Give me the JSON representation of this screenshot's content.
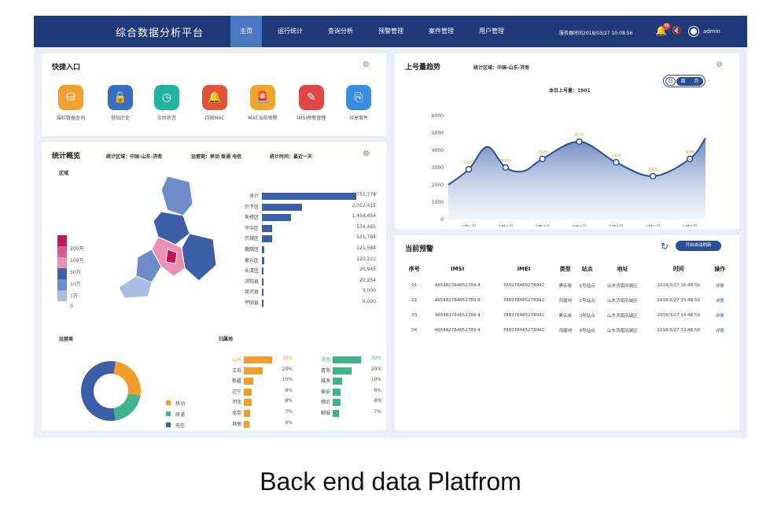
{
  "app": {
    "title": "综合数据分析平台",
    "nav": [
      "主页",
      "运行统计",
      "查询分析",
      "预警管理",
      "案件管理",
      "用户管理"
    ],
    "active_nav": "主页",
    "server_time": "服务器时间2018/03/27 10:08:56",
    "notification_count": "99",
    "user": "admin"
  },
  "quick": {
    "title": "快捷入口",
    "items": [
      {
        "label": "围栏数据查询",
        "icon": "database-search-icon",
        "color": "#f0a030"
      },
      {
        "label": "登陆历史",
        "icon": "lock-icon",
        "color": "#3a6cc0"
      },
      {
        "label": "实时状态",
        "icon": "clock-icon",
        "color": "#22b2a0"
      },
      {
        "label": "待宿MAC",
        "icon": "alarm-bell-icon",
        "color": "#e0543a"
      },
      {
        "label": "MAC当前预警",
        "icon": "siren-icon",
        "color": "#f2a42a"
      },
      {
        "label": "IMSI预警管理",
        "icon": "document-edit-icon",
        "color": "#e04848"
      },
      {
        "label": "共享案件",
        "icon": "share-document-icon",
        "color": "#3a8ce0"
      }
    ]
  },
  "stats": {
    "title": "统计概览",
    "region_label": "统计区域：中国-山东-济南",
    "carrier_label": "运营商：移动 联通 电信",
    "time_label": "统计时间：最近一天",
    "map_label": "区域",
    "legend": [
      {
        "label": "200万",
        "color": "#c2185b"
      },
      {
        "label": "100万",
        "color": "#d8598a"
      },
      {
        "label": "50万",
        "color": "#e891b3"
      },
      {
        "label": "10万",
        "color": "#3d5fa8"
      },
      {
        "label": "1万",
        "color": "#6d8cc8"
      },
      {
        "label": "0",
        "color": "#a9bde3"
      }
    ],
    "districts": [
      {
        "name": "总计",
        "value": 4755778,
        "label": "4,755,778"
      },
      {
        "name": "历下区",
        "value": 2012415,
        "label": "2,012,415"
      },
      {
        "name": "天桥区",
        "value": 1454454,
        "label": "1,454,454"
      },
      {
        "name": "市中区",
        "value": 534465,
        "label": "534,465"
      },
      {
        "name": "历城区",
        "value": 531784,
        "label": "531,784"
      },
      {
        "name": "槐荫区",
        "value": 121584,
        "label": "121,584"
      },
      {
        "name": "章丘区",
        "value": 120222,
        "label": "120,222"
      },
      {
        "name": "长清区",
        "value": 20945,
        "label": "20,945"
      },
      {
        "name": "济阳县",
        "value": 20254,
        "label": "20,254"
      },
      {
        "name": "商河县",
        "value": 9000,
        "label": "9,000"
      },
      {
        "name": "平阴县",
        "value": 9000,
        "label": "9,000"
      }
    ],
    "carrier_title": "运营商",
    "carriers": [
      {
        "name": "移动",
        "value": 25,
        "color": "#f29c2b"
      },
      {
        "name": "联通",
        "value": 20,
        "color": "#3fb38a"
      },
      {
        "name": "电信",
        "value": 55,
        "color": "#3a5ea8"
      }
    ],
    "home_title": "归属地",
    "provinces": [
      {
        "name": "山东",
        "value": 30,
        "label": "30%"
      },
      {
        "name": "江苏",
        "value": 20,
        "label": "20%"
      },
      {
        "name": "新疆",
        "value": 10,
        "label": "10%"
      },
      {
        "name": "辽宁",
        "value": 8,
        "label": "8%"
      },
      {
        "name": "河北",
        "value": 8,
        "label": "8%"
      },
      {
        "name": "北京",
        "value": 7,
        "label": "7%"
      },
      {
        "name": "其他",
        "value": 6,
        "label": "6%"
      }
    ],
    "cities": [
      {
        "name": "济南",
        "value": 30,
        "label": "30%"
      },
      {
        "name": "青岛",
        "value": 20,
        "label": "20%"
      },
      {
        "name": "威海",
        "value": 10,
        "label": "10%"
      },
      {
        "name": "泰安",
        "value": 8,
        "label": "8%"
      },
      {
        "name": "临沂",
        "value": 8,
        "label": "8%"
      },
      {
        "name": "聊城",
        "value": 7,
        "label": "7%"
      }
    ]
  },
  "trend": {
    "title": "上号量趋势",
    "region_label": "统计区域：中国-山东-济南",
    "today_label": "本日上号量：1901",
    "toggle": [
      "日",
      "周",
      "月"
    ],
    "active_toggle": "日"
  },
  "alerts": {
    "title": "当前预警",
    "auto_refresh": "开启自动刷新",
    "columns": [
      "序号",
      "IMSI",
      "IMEI",
      "类型",
      "站点",
      "地址",
      "时间",
      "操作"
    ],
    "rows": [
      [
        "01",
        "465482784652789 4",
        "788278465278942",
        "黑名单",
        "1号站点",
        "山东济南历城区",
        "2018/3/27 16:48:59",
        "详情"
      ],
      [
        "02",
        "465482784652789 4",
        "788278465278942",
        "归属地",
        "2号站点",
        "山东济南历城区",
        "2018/3/27 15:48:59",
        "详情"
      ],
      [
        "03",
        "465482784652789 4",
        "788278465278942",
        "黑名单",
        "3号站点",
        "山东济南历城区",
        "2018/3/27 14:48:59",
        "详情"
      ],
      [
        "04",
        "465482784652789 4",
        "788278465278942",
        "归属地",
        "4号站点",
        "山东济南历城区",
        "2018/3/27 13:48:59",
        "详情"
      ]
    ]
  },
  "chart_data": {
    "type": "area",
    "x": [
      "3月1号",
      "3月2号",
      "3月3号",
      "3月4号",
      "3月5号",
      "3月6号",
      "3月7号"
    ],
    "series": [
      {
        "values": [
          2900,
          3000,
          3500,
          4500,
          3300,
          2500,
          3500
        ]
      }
    ],
    "ylim": [
      0,
      6000
    ],
    "yticks": [
      0,
      1000,
      2000,
      3000,
      4000,
      5000,
      6000
    ],
    "xlabel": "",
    "ylabel": "",
    "grid": false
  },
  "caption": "Back end data Platfrom"
}
